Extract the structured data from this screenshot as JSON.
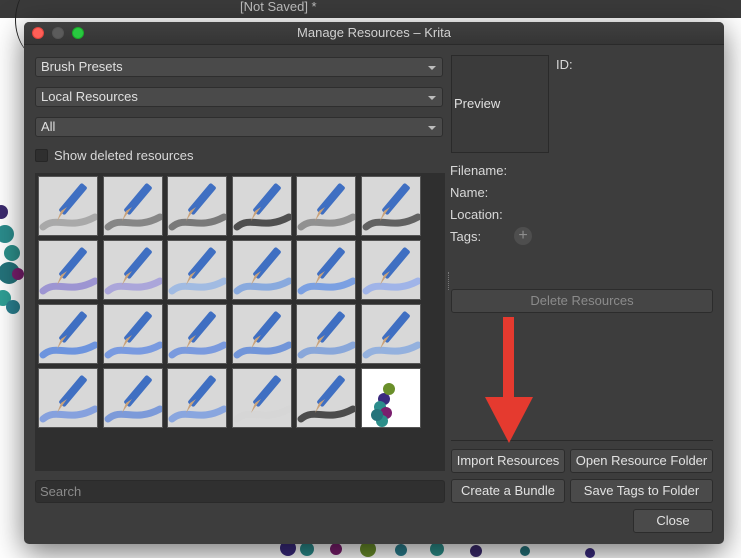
{
  "background": {
    "doc_title": "[Not Saved]  *"
  },
  "window": {
    "title": "Manage Resources – Krita"
  },
  "left_panel": {
    "resource_type": "Brush Presets",
    "storage": "Local Resources",
    "tag_filter": "All",
    "show_deleted_label": "Show deleted resources",
    "show_deleted_checked": false,
    "search_placeholder": "Search",
    "presets": [
      "eraser-preset",
      "pencil-soft-preset",
      "pencil-sketch-preset",
      "ink-pen-preset",
      "marker-preset",
      "marker-dark-preset",
      "palette-knife-preset",
      "watercolor-wet-preset",
      "watercolor-light-preset",
      "brush-thin-preset",
      "brush-blue-preset",
      "brush-blend-preset",
      "brush-round-preset",
      "brush-smudge-preset",
      "brush-rotate-preset",
      "brush-rotate-2-preset",
      "spray-preset",
      "sponge-preset",
      "brush-flat-preset",
      "brush-bristle-preset",
      "brush-texture-preset",
      "watercolor-wash-preset",
      "ink-brush-preset",
      "dots-preset"
    ]
  },
  "right_panel": {
    "preview_label": "Preview",
    "id_label": "ID:",
    "filename_label": "Filename:",
    "name_label": "Name:",
    "location_label": "Location:",
    "tags_label": "Tags:",
    "add_tag_icon": "+",
    "delete_button": "Delete Resources",
    "import_button": "Import Resources",
    "open_folder_button": "Open Resource Folder",
    "create_bundle_button": "Create a Bundle",
    "save_tags_button": "Save Tags to Folder",
    "close_button": "Close"
  },
  "colors": {
    "dialog_bg": "#3d3d3d",
    "annotation_arrow": "#e53a2f",
    "close_dot": "#fe5f57",
    "max_dot": "#28c840"
  }
}
